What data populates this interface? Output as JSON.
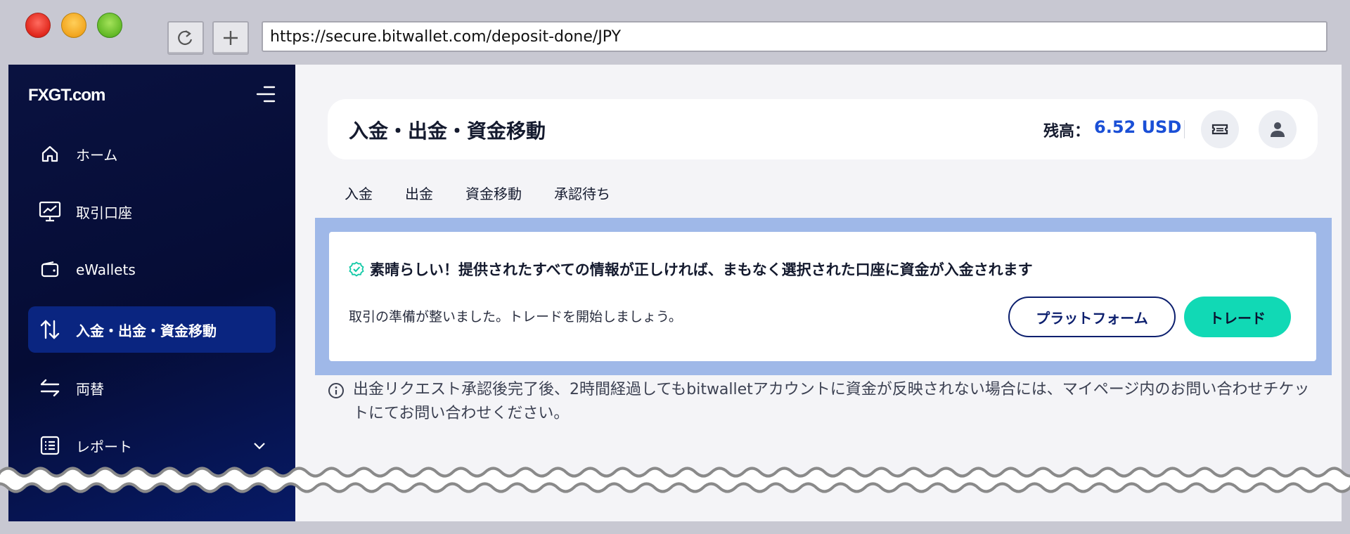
{
  "browser": {
    "url": "https://secure.bitwallet.com/deposit-done/JPY"
  },
  "sidebar": {
    "logo": "FXGT.com",
    "items": [
      {
        "label": "ホーム",
        "icon": "home-icon"
      },
      {
        "label": "取引口座",
        "icon": "chart-monitor-icon"
      },
      {
        "label": "eWallets",
        "icon": "wallet-icon"
      },
      {
        "label": "入金・出金・資金移動",
        "icon": "transfer-arrows-icon",
        "active": true
      },
      {
        "label": "両替",
        "icon": "exchange-icon"
      },
      {
        "label": "レポート",
        "icon": "report-list-icon",
        "expandable": true
      }
    ]
  },
  "header": {
    "title": "入金・出金・資金移動",
    "balance_label": "残高：",
    "balance_value": "6.52 USD"
  },
  "tabs": [
    "入金",
    "出金",
    "資金移動",
    "承認待ち"
  ],
  "success": {
    "title": "素晴らしい！提供されたすべての情報が正しければ、まもなく選択された口座に資金が入金されます",
    "subtitle": "取引の準備が整いました。トレードを開始しましょう。",
    "platform_button": "プラットフォーム",
    "trade_button": "トレード"
  },
  "notice": "出金リクエスト承認後完了後、2時間経過してもbitwalletアカウントに資金が反映されない場合には、マイページ内のお問い合わせチケットにてお問い合わせください。",
  "colors": {
    "sidebar_bg": "#050c35",
    "active_item": "#0a2580",
    "accent_blue": "#1a4fd6",
    "trade_green": "#11d9b5",
    "highlight": "#9fb8e8"
  }
}
